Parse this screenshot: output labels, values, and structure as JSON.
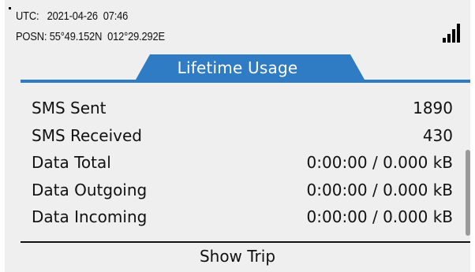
{
  "status": {
    "utc_line": "UTC:   2021-04-26  07:46",
    "posn_line": "POSN: 55°49.152N  012°29.292E",
    "signal_icon": "signal-strength-icon"
  },
  "tab": {
    "title": "Lifetime Usage",
    "accent_color": "#2f7bc4"
  },
  "rows": [
    {
      "label": "SMS Sent",
      "value": "1890"
    },
    {
      "label": "SMS Received",
      "value": "430"
    },
    {
      "label": "Data Total",
      "value": "0:00:00 / 0.000 kB"
    },
    {
      "label": "Data Outgoing",
      "value": "0:00:00 / 0.000 kB"
    },
    {
      "label": "Data Incoming",
      "value": "0:00:00 / 0.000 kB"
    }
  ],
  "footer": {
    "show_trip_label": "Show Trip"
  }
}
